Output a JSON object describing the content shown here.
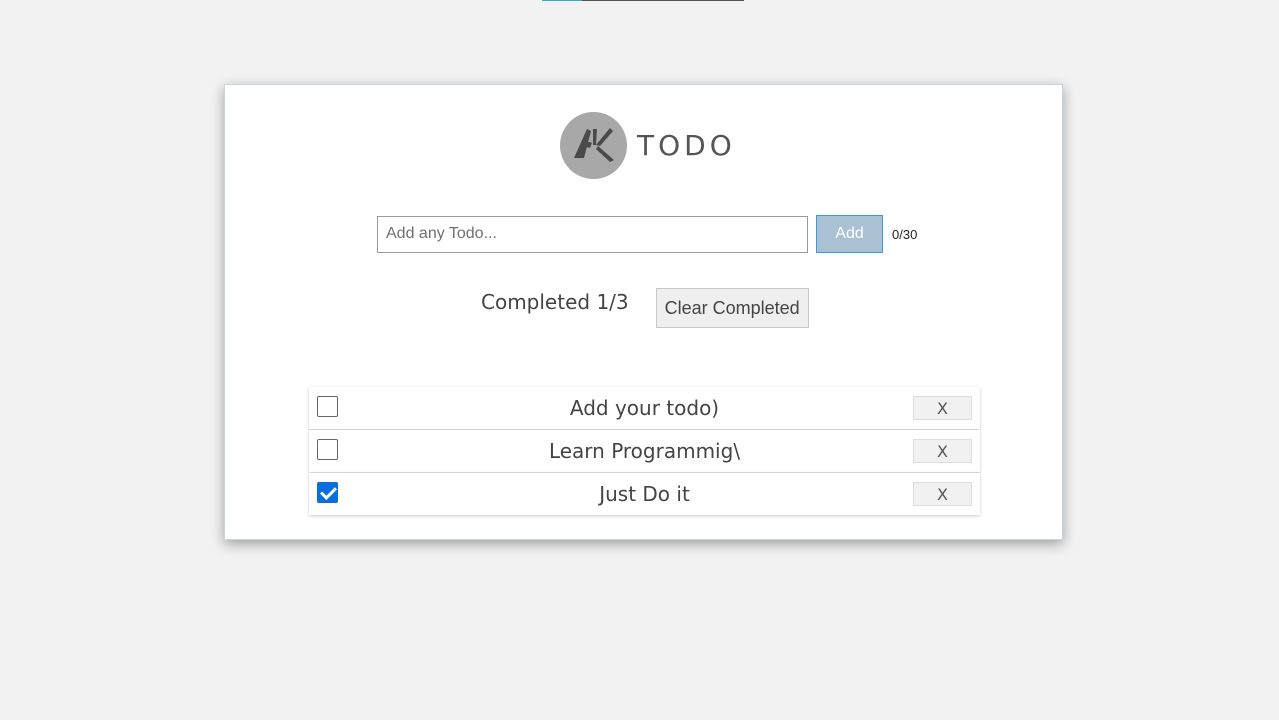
{
  "app": {
    "logo_monogram": "AK",
    "title": "TODO"
  },
  "input": {
    "placeholder": "Add any Todo...",
    "value": "",
    "add_label": "Add",
    "char_count": "0/30"
  },
  "status": {
    "completed_text": "Completed 1/3",
    "clear_label": "Clear Completed"
  },
  "todos": [
    {
      "text": "Add your todo)",
      "done": false,
      "delete_label": "X"
    },
    {
      "text": "Learn Programmig\\",
      "done": false,
      "delete_label": "X"
    },
    {
      "text": "Just Do it",
      "done": true,
      "delete_label": "X"
    }
  ],
  "colors": {
    "background": "#f2f2f2",
    "card": "#ffffff",
    "add_button": "#a9c1d3",
    "check_accent": "#0a6fdc",
    "logo": "#a8a8a8"
  }
}
